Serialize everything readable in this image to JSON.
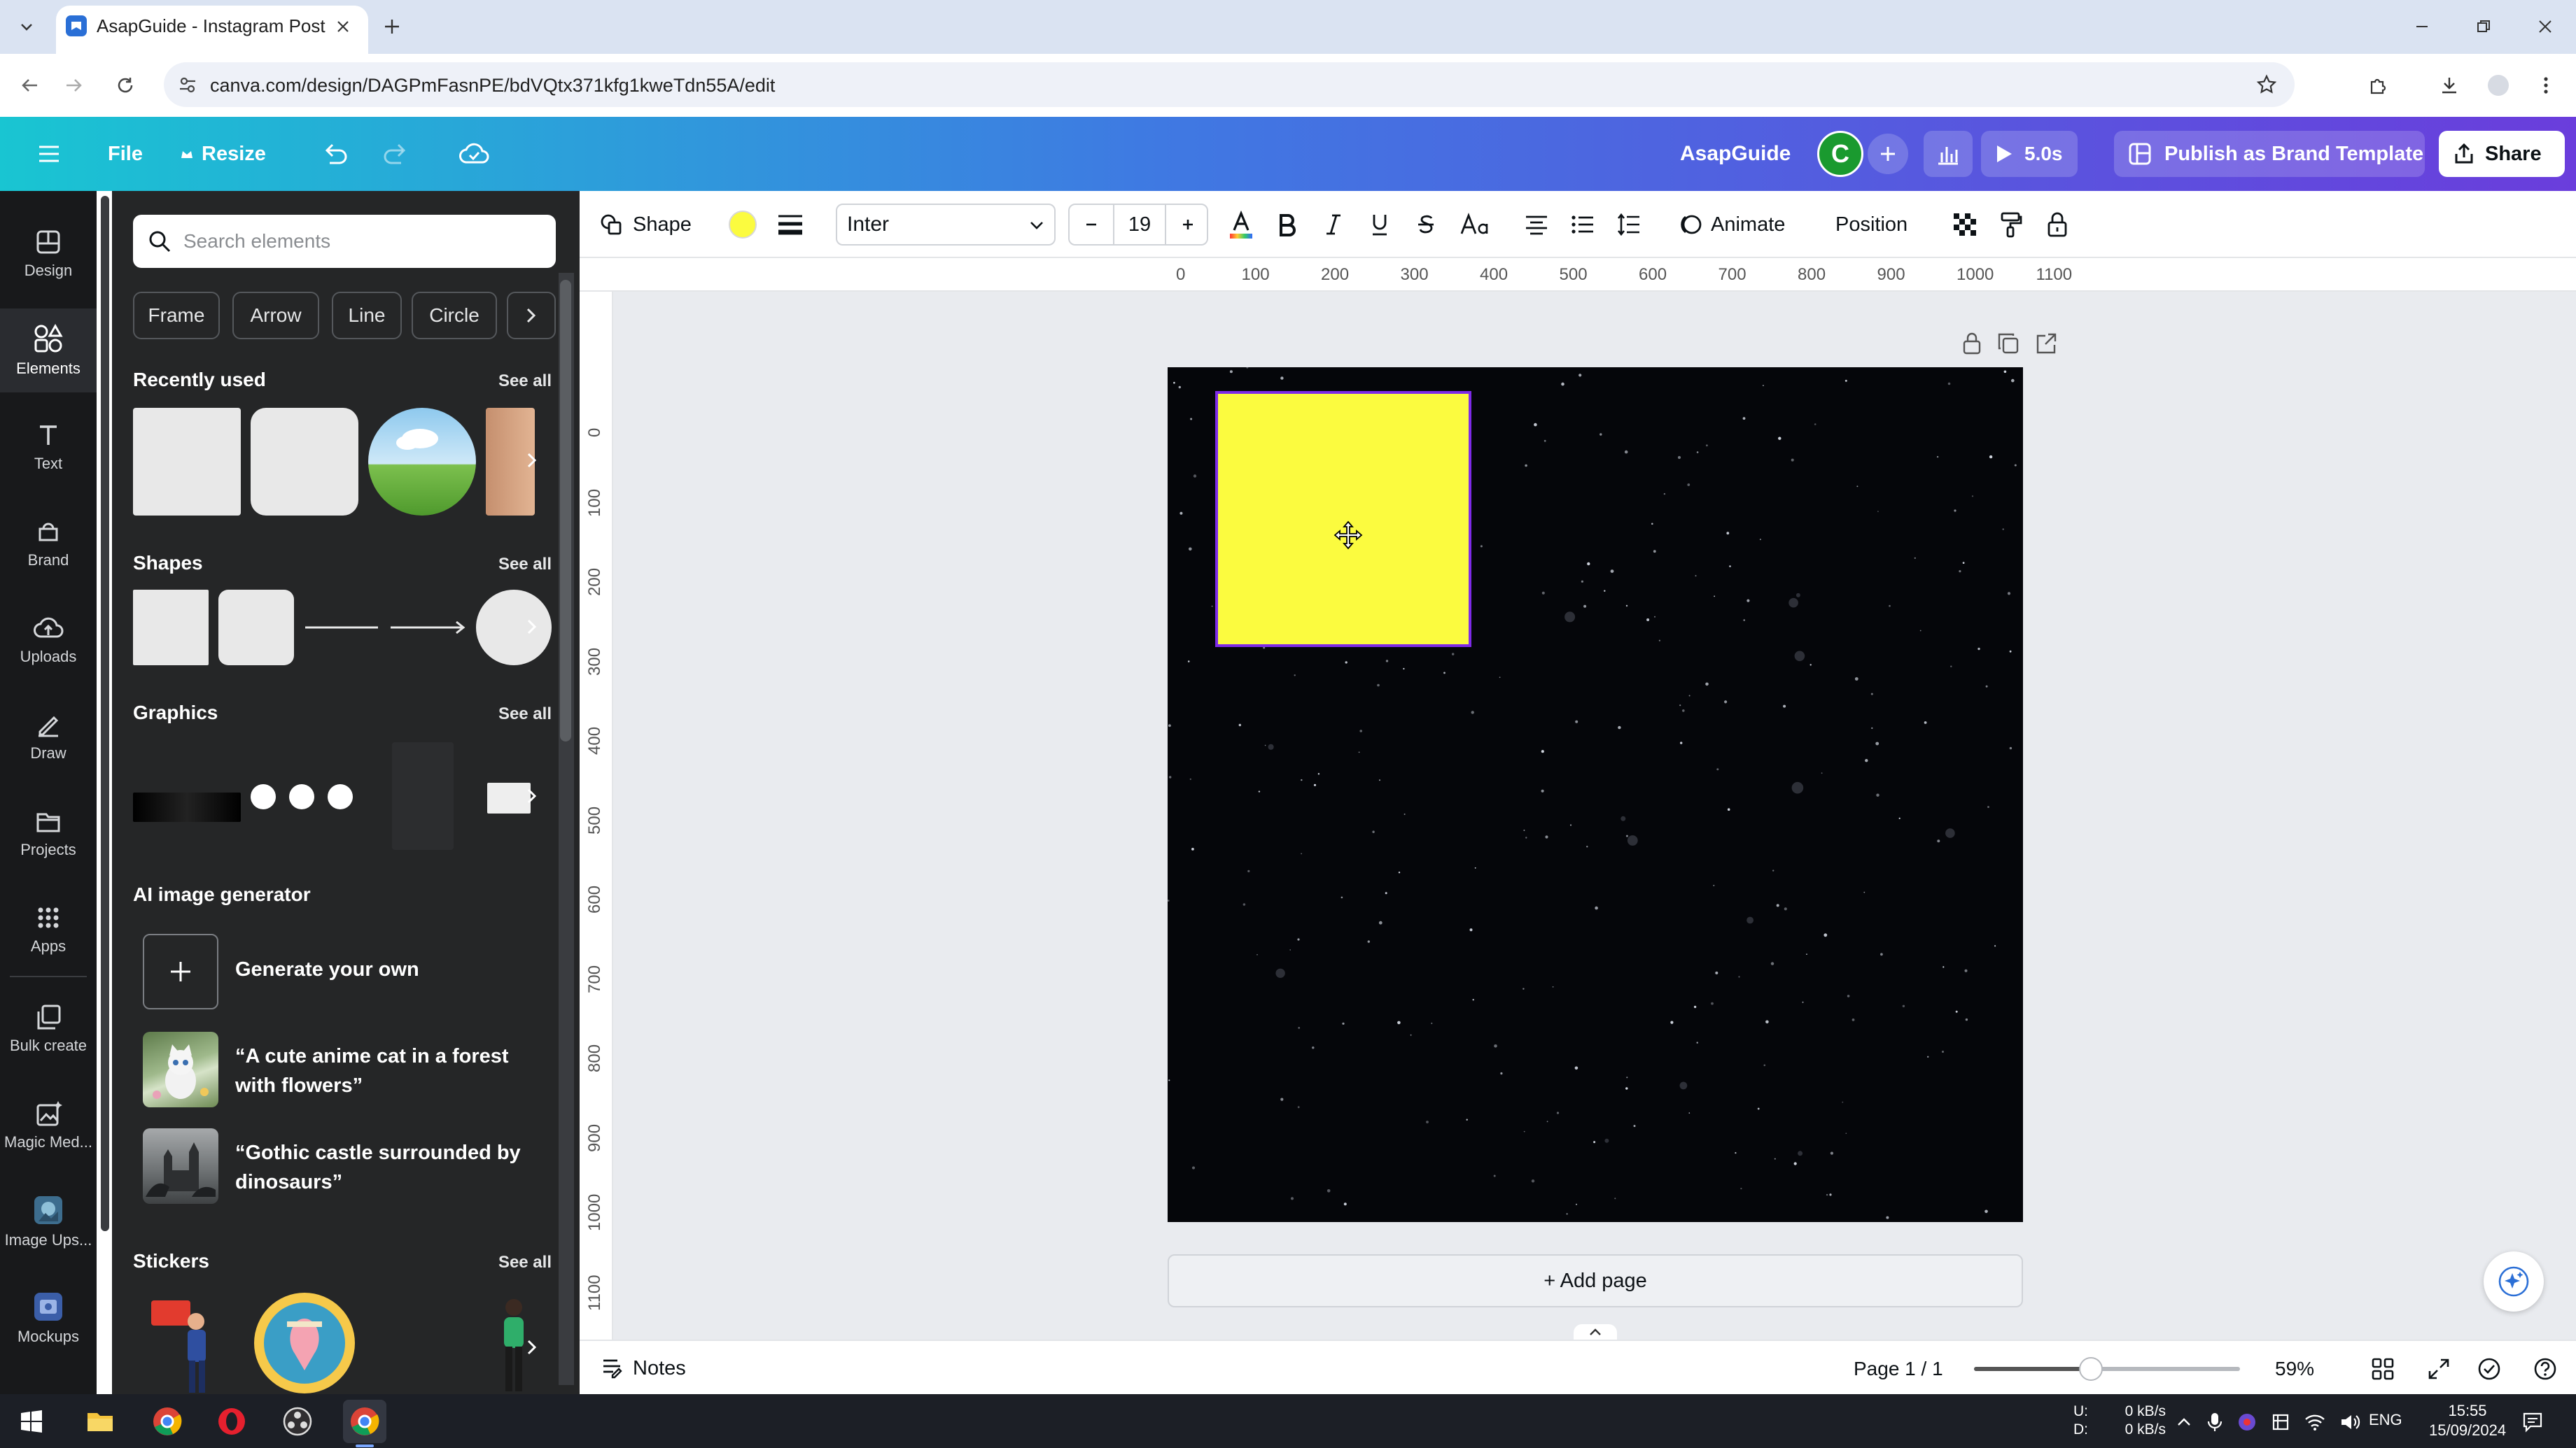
{
  "browser": {
    "tab_title": "AsapGuide - Instagram Post",
    "url": "canva.com/design/DAGPmFasnPE/bdVQtx371kfg1kweTdn55A/edit"
  },
  "header": {
    "menu_icon": "hamburger-icon",
    "file_label": "File",
    "resize_label": "Resize",
    "brand_name": "AsapGuide",
    "avatar_initial": "C",
    "present_time": "5.0s",
    "publish_label": "Publish as Brand Template",
    "share_label": "Share"
  },
  "rail": {
    "items": [
      {
        "label": "Design",
        "icon": "design-icon"
      },
      {
        "label": "Elements",
        "icon": "elements-icon"
      },
      {
        "label": "Text",
        "icon": "text-icon"
      },
      {
        "label": "Brand",
        "icon": "brand-icon"
      },
      {
        "label": "Uploads",
        "icon": "uploads-icon"
      },
      {
        "label": "Draw",
        "icon": "draw-icon"
      },
      {
        "label": "Projects",
        "icon": "projects-icon"
      },
      {
        "label": "Apps",
        "icon": "apps-icon"
      },
      {
        "label": "Bulk create",
        "icon": "bulk-create-icon"
      },
      {
        "label": "Magic Med...",
        "icon": "magic-media-icon"
      },
      {
        "label": "Image Ups...",
        "icon": "image-upscaler-icon"
      },
      {
        "label": "Mockups",
        "icon": "mockups-icon"
      }
    ]
  },
  "panel": {
    "search_placeholder": "Search elements",
    "chips": [
      "Frame",
      "Arrow",
      "Line",
      "Circle"
    ],
    "recently_used": "Recently used",
    "shapes": "Shapes",
    "graphics": "Graphics",
    "ai_generator": "AI image generator",
    "generate_own": "Generate your own",
    "ai_examples": [
      "“A cute anime cat in a forest with flowers”",
      "“Gothic castle surrounded by dinosaurs”"
    ],
    "stickers": "Stickers",
    "see_all": "See all"
  },
  "toolbar": {
    "shape_label": "Shape",
    "fill_color": "#fbfb3f",
    "font_name": "Inter",
    "font_size": "19",
    "animate_label": "Animate",
    "position_label": "Position"
  },
  "ruler": {
    "h_ticks": [
      "0",
      "100",
      "200",
      "300",
      "400",
      "500",
      "600",
      "700",
      "800",
      "900",
      "1000",
      "1100"
    ],
    "v_ticks": [
      "0",
      "100",
      "200",
      "300",
      "400",
      "500",
      "600",
      "700",
      "800",
      "900",
      "1000",
      "1100"
    ]
  },
  "canvas": {
    "background_color": "#05060a",
    "rect_color": "#fbfb3f",
    "selection_color": "#7d2ae8",
    "add_page_label": "+ Add page"
  },
  "footer": {
    "notes_label": "Notes",
    "page_indicator": "Page 1 / 1",
    "zoom": "59%",
    "zoom_fraction": 0.59
  },
  "taskbar": {
    "net_labels": "U:\nD:",
    "net_speeds": "0 kB/s\n0 kB/s",
    "lang": "ENG",
    "time": "15:55",
    "date": "15/09/2024"
  }
}
